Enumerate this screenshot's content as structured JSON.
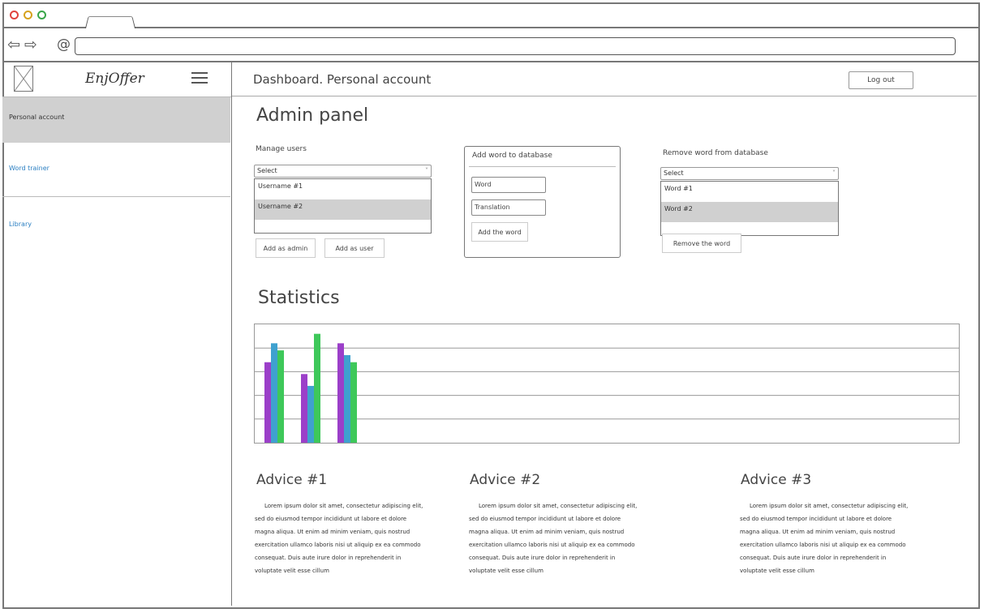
{
  "browser": {
    "back_icon": "arrow-left-icon",
    "forward_icon": "arrow-right-icon",
    "address_icon": "at-icon",
    "url": ""
  },
  "sidebar": {
    "brand": "EnjOffer",
    "items": [
      {
        "label": "Personal account",
        "active": true
      },
      {
        "label": "Word trainer",
        "active": false
      },
      {
        "label": "Library",
        "active": false
      }
    ]
  },
  "header": {
    "title": "Dashboard. Personal account",
    "logout_label": "Log out"
  },
  "admin": {
    "title": "Admin panel",
    "manage_users": {
      "label": "Manage users",
      "select_value": "Select",
      "options": [
        "Username #1",
        "Username #2"
      ],
      "selected_index": 1,
      "add_admin_label": "Add as admin",
      "add_user_label": "Add as user"
    },
    "add_word": {
      "title": "Add word to database",
      "word_placeholder": "Word",
      "translation_placeholder": "Translation",
      "button_label": "Add the word"
    },
    "remove_word": {
      "label": "Remove word from database",
      "select_value": "Select",
      "options": [
        "Word #1",
        "Word #2"
      ],
      "selected_index": 1,
      "button_label": "Remove the word"
    }
  },
  "statistics": {
    "title": "Statistics"
  },
  "chart_data": {
    "type": "bar",
    "categories": [
      "",
      "",
      ""
    ],
    "series": [
      {
        "color": "#9b3fc9",
        "values": [
          3.4,
          2.9,
          4.2
        ]
      },
      {
        "color": "#3fa1cf",
        "values": [
          4.2,
          2.4,
          3.7
        ]
      },
      {
        "color": "#3ec85a",
        "values": [
          3.9,
          4.6,
          3.4
        ]
      }
    ],
    "ylim": [
      0,
      5
    ],
    "grid": true,
    "title": "",
    "xlabel": "",
    "ylabel": ""
  },
  "advice": [
    {
      "title": "Advice #1",
      "body": "Lorem ipsum dolor sit amet, consectetur adipiscing elit, sed do eiusmod tempor incididunt ut labore et dolore magna aliqua. Ut enim ad minim veniam, quis nostrud exercitation ullamco laboris nisi ut aliquip ex ea commodo consequat. Duis aute irure dolor in reprehenderit in voluptate velit esse cillum"
    },
    {
      "title": "Advice #2",
      "body": "Lorem ipsum dolor sit amet, consectetur adipiscing elit, sed do eiusmod tempor incididunt ut labore et dolore magna aliqua. Ut enim ad minim veniam, quis nostrud exercitation ullamco laboris nisi ut aliquip ex ea commodo consequat. Duis aute irure dolor in reprehenderit in voluptate velit esse cillum"
    },
    {
      "title": "Advice #3",
      "body": "Lorem ipsum dolor sit amet, consectetur adipiscing elit, sed do eiusmod tempor incididunt ut labore et dolore magna aliqua. Ut enim ad minim veniam, quis nostrud exercitation ullamco laboris nisi ut aliquip ex ea commodo consequat. Duis aute irure dolor in reprehenderit in voluptate velit esse cillum"
    }
  ]
}
